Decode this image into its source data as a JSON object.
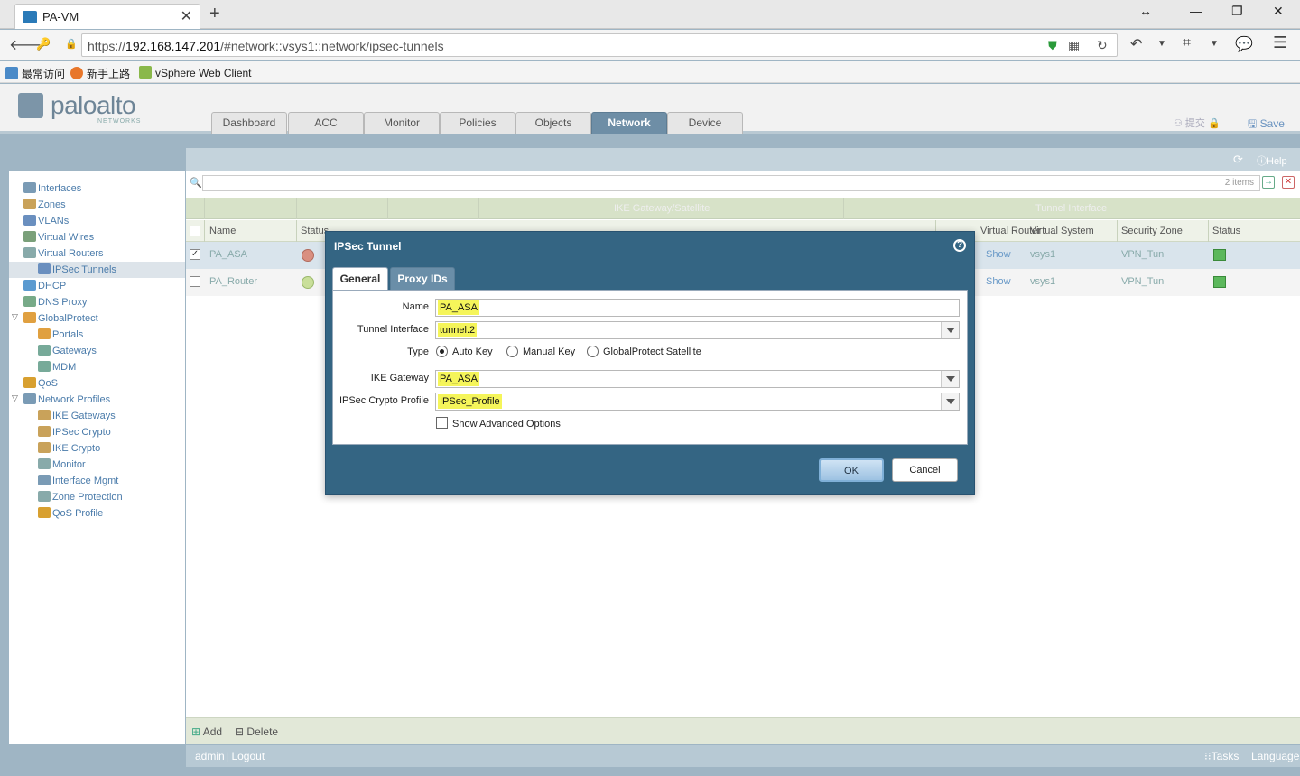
{
  "browser": {
    "tab_title": "PA-VM",
    "tab_close": "✕",
    "new_tab": "+",
    "url_prefix": "https://",
    "url_host": "192.168.147.201",
    "url_path": "/#network::vsys1::network/ipsec-tunnels",
    "bookmarks": [
      "最常访问",
      "新手上路",
      "vSphere Web Client"
    ]
  },
  "app": {
    "logo_text": "paloalto",
    "logo_sub": "NETWORKS",
    "tabs": [
      "Dashboard",
      "ACC",
      "Monitor",
      "Policies",
      "Objects",
      "Network",
      "Device"
    ],
    "active_tab": "Network",
    "commit_label": "提交",
    "save_label": "Save",
    "help_label": "Help"
  },
  "sidebar": {
    "items": [
      {
        "label": "Interfaces"
      },
      {
        "label": "Zones"
      },
      {
        "label": "VLANs"
      },
      {
        "label": "Virtual Wires"
      },
      {
        "label": "Virtual Routers"
      },
      {
        "label": "IPSec Tunnels",
        "selected": true
      },
      {
        "label": "DHCP"
      },
      {
        "label": "DNS Proxy"
      },
      {
        "label": "GlobalProtect"
      },
      {
        "label": "Portals"
      },
      {
        "label": "Gateways"
      },
      {
        "label": "MDM"
      },
      {
        "label": "QoS"
      },
      {
        "label": "Network Profiles"
      },
      {
        "label": "IKE Gateways"
      },
      {
        "label": "IPSec Crypto"
      },
      {
        "label": "IKE Crypto"
      },
      {
        "label": "Monitor"
      },
      {
        "label": "Interface Mgmt"
      },
      {
        "label": "Zone Protection"
      },
      {
        "label": "QoS Profile"
      }
    ]
  },
  "table": {
    "item_count": "2 items",
    "group_headers": [
      "IKE Gateway/Satellite",
      "Tunnel Interface"
    ],
    "columns": [
      "Name",
      "Status",
      "Virtual Router",
      "Virtual System",
      "Security Zone",
      "Status"
    ],
    "rows": [
      {
        "name": "PA_ASA",
        "checked": true,
        "vr": "Show",
        "vsys": "vsys1",
        "zone": "VPN_Tun"
      },
      {
        "name": "PA_Router",
        "checked": false,
        "vr": "Show",
        "vsys": "vsys1",
        "zone": "VPN_Tun"
      }
    ],
    "status_colors": {
      "down": "#d98f80",
      "up": "#c9df9a"
    }
  },
  "footer": {
    "add": "Add",
    "delete": "Delete"
  },
  "statusbar": {
    "user": "admin",
    "logout": "Logout",
    "tasks": "Tasks",
    "language": "Language"
  },
  "dialog": {
    "title": "IPSec Tunnel",
    "tabs": [
      "General",
      "Proxy IDs"
    ],
    "active_tab": "General",
    "fields": {
      "name_label": "Name",
      "name_value": "PA_ASA",
      "tunnel_label": "Tunnel Interface",
      "tunnel_value": "tunnel.2",
      "type_label": "Type",
      "type_options": [
        "Auto Key",
        "Manual Key",
        "GlobalProtect Satellite"
      ],
      "type_selected": "Auto Key",
      "ike_label": "IKE Gateway",
      "ike_value": "PA_ASA",
      "crypto_label": "IPSec Crypto Profile",
      "crypto_value": "IPSec_Profile",
      "advanced_label": "Show Advanced Options",
      "advanced_checked": false
    },
    "ok": "OK",
    "cancel": "Cancel"
  }
}
